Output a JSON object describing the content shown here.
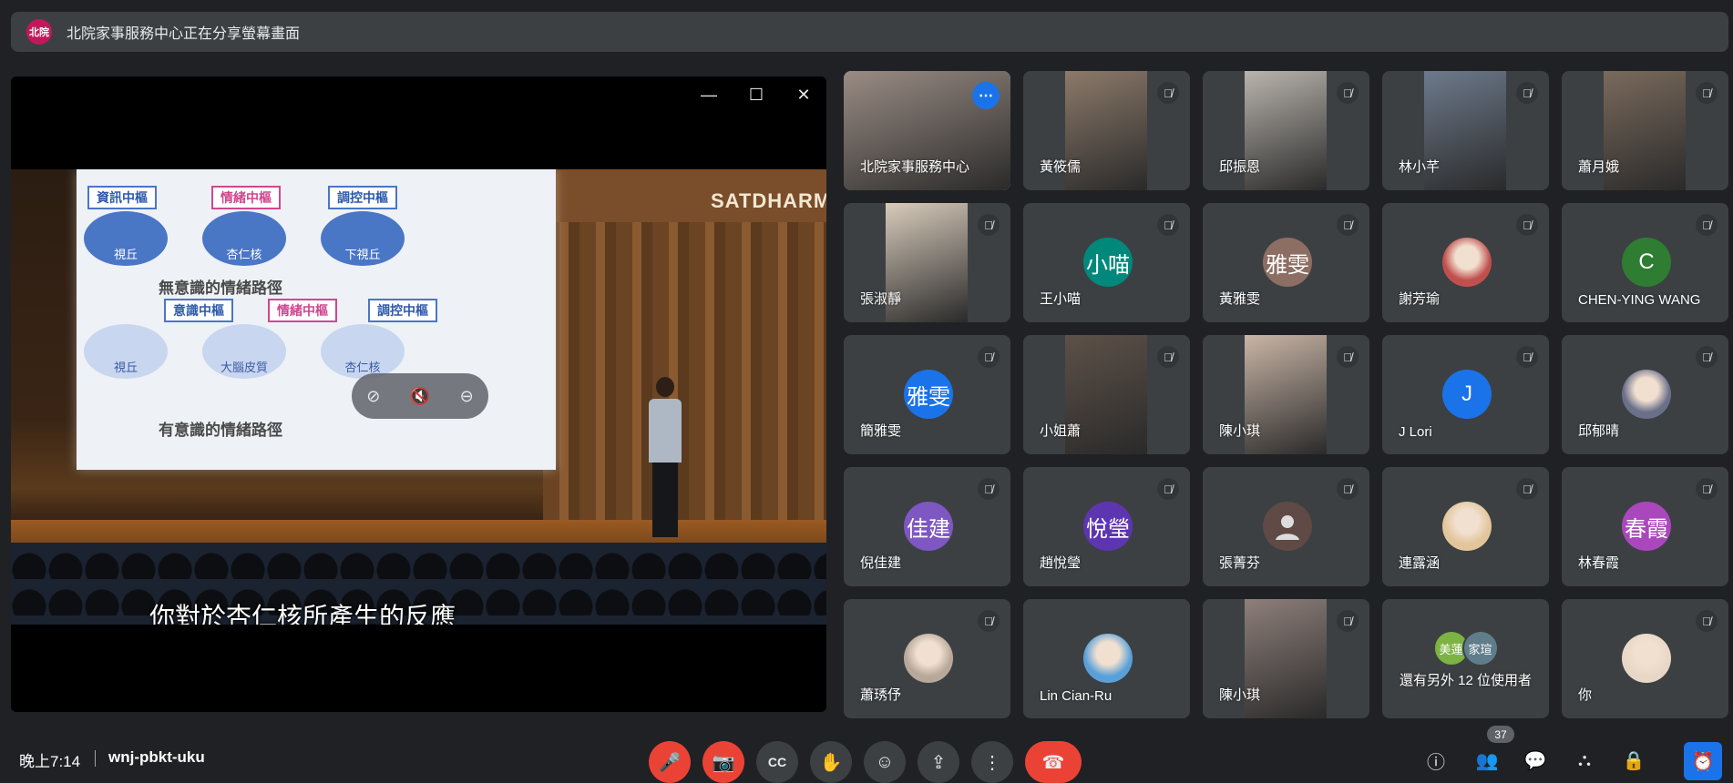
{
  "banner": {
    "badge": "北院",
    "text": "北院家事服務中心正在分享螢幕畫面"
  },
  "presentation": {
    "subtitle": "你對於杏仁核所產生的反應",
    "logo": "SATDHARMA",
    "slide": {
      "tags_top": [
        "資訊中樞",
        "情緒中樞",
        "調控中樞"
      ],
      "nodes_top": [
        "視丘",
        "杏仁核",
        "下視丘"
      ],
      "caption_top": "無意識的情緒路徑",
      "tags_bottom": [
        "意識中樞",
        "情緒中樞",
        "調控中樞"
      ],
      "nodes_bottom": [
        "視丘",
        "大腦皮質",
        "杏仁核"
      ],
      "caption_bottom": "有意識的情緒路徑"
    },
    "window_controls": {
      "minimize": "—",
      "maximize": "☐",
      "close": "✕"
    },
    "media_controls": {
      "unpin": "⊘",
      "mute": "🔇",
      "remove": "⊖"
    }
  },
  "participants": [
    {
      "name": "北院家事服務中心",
      "type": "photo",
      "color": "#9a8c84",
      "active": true
    },
    {
      "name": "黃筱儒",
      "type": "photo",
      "color": "#8c7a6a",
      "muted": true
    },
    {
      "name": "邱振恩",
      "type": "photo",
      "color": "#b9b4ad",
      "muted": true
    },
    {
      "name": "林小芊",
      "type": "photo",
      "color": "#6d7a8c",
      "muted": true
    },
    {
      "name": "蕭月娥",
      "type": "photo",
      "color": "#7a6a5c",
      "muted": true
    },
    {
      "name": "張淑靜",
      "type": "photo",
      "color": "#d8cbbb",
      "muted": true
    },
    {
      "name": "王小喵",
      "type": "initial",
      "initial": "小喵",
      "color": "#00897b",
      "muted": true
    },
    {
      "name": "黃雅雯",
      "type": "initial",
      "initial": "雅雯",
      "color": "#8d6e63",
      "muted": true
    },
    {
      "name": "謝芳瑜",
      "type": "photo-avatar",
      "color": "#c0504d",
      "muted": true
    },
    {
      "name": "CHEN-YING WANG",
      "type": "initial",
      "initial": "C",
      "color": "#2e7d32",
      "muted": true
    },
    {
      "name": "簡雅雯",
      "type": "initial",
      "initial": "雅雯",
      "color": "#1a73e8",
      "muted": true
    },
    {
      "name": "小姐蕭",
      "type": "photo",
      "color": "#5d5148",
      "muted": true
    },
    {
      "name": "陳小琪",
      "type": "photo",
      "color": "#c9b5a6",
      "muted": true
    },
    {
      "name": "J Lori",
      "type": "initial",
      "initial": "J",
      "color": "#1a73e8",
      "muted": true
    },
    {
      "name": "邱郁晴",
      "type": "photo-avatar",
      "color": "#6a6f8a",
      "muted": true
    },
    {
      "name": "倪佳建",
      "type": "initial",
      "initial": "佳建",
      "color": "#7e57c2",
      "muted": true
    },
    {
      "name": "趙悅瑩",
      "type": "initial",
      "initial": "悅瑩",
      "color": "#5e35b1",
      "muted": true
    },
    {
      "name": "張菁芬",
      "type": "placeholder",
      "color": "#5f4a45",
      "muted": true
    },
    {
      "name": "連露涵",
      "type": "photo-avatar",
      "color": "#e2c59a",
      "muted": true
    },
    {
      "name": "林春霞",
      "type": "initial",
      "initial": "春霞",
      "color": "#ab47bc",
      "muted": true
    },
    {
      "name": "蕭琇伃",
      "type": "photo-avatar",
      "color": "#b7a89a",
      "muted": true
    },
    {
      "name": "Lin Cian-Ru",
      "type": "photo-avatar",
      "color": "#5aa0d8",
      "muted": false
    },
    {
      "name": "陳小琪",
      "type": "photo",
      "color": "#8e7f7a",
      "muted": true
    },
    {
      "name": "還有另外 12 位使用者",
      "type": "others",
      "initials": [
        "美蓮",
        "家瑄"
      ],
      "colors": [
        "#7cb342",
        "#607d8b"
      ]
    },
    {
      "name": "你",
      "type": "photo-avatar",
      "color": "#e8d7c7",
      "muted": true
    }
  ],
  "bottom": {
    "time": "晚上7:14",
    "meeting_code": "wnj-pbkt-uku",
    "participant_count": "37",
    "controls": {
      "mic": "🎤",
      "camera": "📷",
      "captions": "CC",
      "raise_hand": "✋",
      "reactions": "☺",
      "present": "⇪",
      "more": "⋮",
      "leave": "☎"
    },
    "right": {
      "info": "ⓘ",
      "people": "👥",
      "chat": "💬",
      "activities": "⛬",
      "host": "🔒",
      "timer": "⏰"
    }
  }
}
